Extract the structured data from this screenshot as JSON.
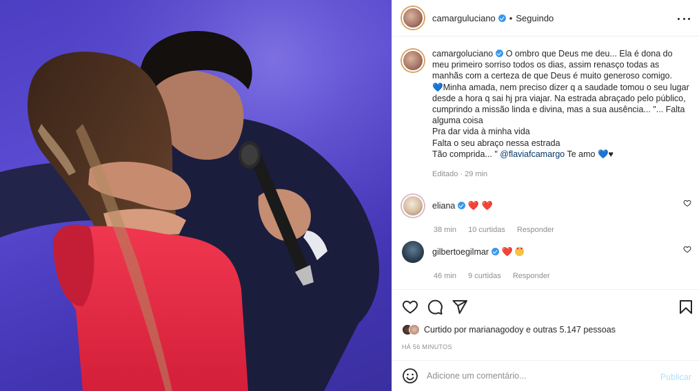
{
  "post": {
    "author": "camarguluciano",
    "follow_status": "Seguindo",
    "separator": "•"
  },
  "caption": {
    "author": "camargoluciano",
    "text_1": "O ombro que Deus me deu... Ela é dona do meu primeiro sorriso todos os dias, assim renasço todas as manhãs com a certeza de que Deus é muito generoso comigo.",
    "blue_heart": "💙",
    "text_2": "Minha amada, nem preciso dizer q a saudade tomou o seu lugar desde a hora q sai hj pra viajar. Na estrada abraçado pelo público, cumprindo a missão linda e divina, mas a sua ausência... \"... Falta alguma coisa",
    "line_3": "Pra dar vida à minha vida",
    "line_4": "Falta o seu abraço nessa estrada",
    "line_5_pre": "Tão comprida... \"",
    "mention": "@flaviafcamargo",
    "line_5_post": "Te amo",
    "black_heart": "♥",
    "meta": "Editado · 29 min"
  },
  "comments": [
    {
      "user": "eliana",
      "emojis": "❤️ ❤️",
      "time": "38 min",
      "likes": "10 curtidas",
      "reply": "Responder"
    },
    {
      "user": "gilbertoegilmar",
      "emojis": "❤️",
      "time": "46 min",
      "likes": "9 curtidas",
      "reply": "Responder"
    }
  ],
  "likes": {
    "text": "Curtido por marianagodoy e outras 5.147 pessoas"
  },
  "timestamp": "HÁ 56 MINUTOS",
  "comment_box": {
    "placeholder": "Adicione um comentário...",
    "publish_label": "Publicar"
  },
  "icons": {
    "more": "more-horizontal-icon",
    "like": "heart-icon",
    "comment": "comment-icon",
    "share": "send-icon",
    "save": "bookmark-icon",
    "emoji": "emoji-icon"
  },
  "colors": {
    "accent_link": "#00376b",
    "verified": "#3897f0",
    "heart_red": "#ed4956",
    "muted": "#8e8e8e",
    "publish_disabled": "#b2dffc"
  }
}
